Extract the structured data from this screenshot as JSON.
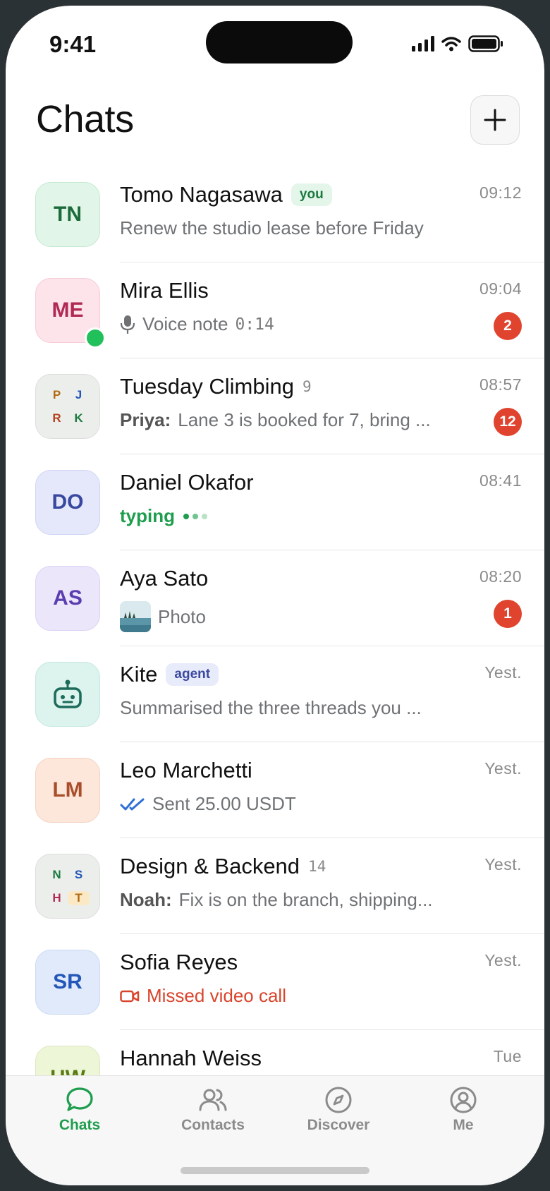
{
  "status_bar": {
    "time": "9:41"
  },
  "header": {
    "title": "Chats"
  },
  "chats": [
    {
      "initials": "TN",
      "name": "Tomo Nagasawa",
      "tag": "you",
      "time": "09:12",
      "preview": "Renew the studio lease before Friday"
    },
    {
      "initials": "ME",
      "name": "Mira Ellis",
      "time": "09:04",
      "preview": "Voice note",
      "duration": "0:14",
      "unread": "2",
      "online": true
    },
    {
      "members": [
        "P",
        "J",
        "R",
        "K"
      ],
      "name": "Tuesday Climbing",
      "count": "9",
      "time": "08:57",
      "sender": "Priya:",
      "preview": "Lane 3 is booked for 7, bring ...",
      "unread": "12"
    },
    {
      "initials": "DO",
      "name": "Daniel Okafor",
      "time": "08:41",
      "preview": "typing"
    },
    {
      "initials": "AS",
      "name": "Aya Sato",
      "time": "08:20",
      "preview": "Photo",
      "unread": "1"
    },
    {
      "name": "Kite",
      "tag": "agent",
      "time": "Yest.",
      "preview": "Summarised the three threads you ..."
    },
    {
      "initials": "LM",
      "name": "Leo Marchetti",
      "time": "Yest.",
      "preview": "Sent 25.00 USDT"
    },
    {
      "members": [
        "N",
        "S",
        "H",
        "T"
      ],
      "name": "Design & Backend",
      "count": "14",
      "time": "Yest.",
      "sender": "Noah:",
      "preview": "Fix is on the branch, shipping..."
    },
    {
      "initials": "SR",
      "name": "Sofia Reyes",
      "time": "Yest.",
      "preview": "Missed video call"
    },
    {
      "initials": "HW",
      "name": "Hannah Weiss",
      "time": "Tue"
    }
  ],
  "tabbar": {
    "chats": "Chats",
    "contacts": "Contacts",
    "discover": "Discover",
    "me": "Me"
  },
  "colors": {
    "accent": "#1f9d4e",
    "badge": "#e0432e",
    "missed": "#d9452c",
    "read_check": "#2f6fd6"
  }
}
